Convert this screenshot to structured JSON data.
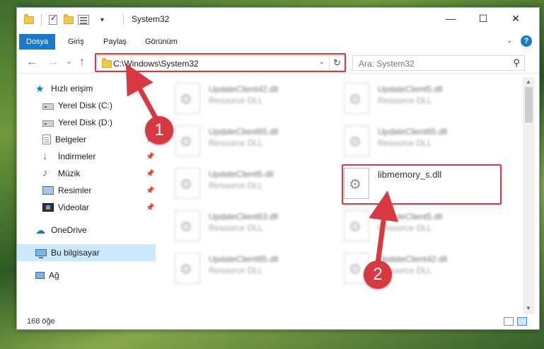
{
  "window": {
    "title": "System32",
    "controls": {
      "minimize": "—",
      "maximize": "☐",
      "close": "✕"
    }
  },
  "ribbon": {
    "tabs": [
      "Dosya",
      "Giriş",
      "Paylaş",
      "Görünüm"
    ],
    "active_tab": "Dosya",
    "help": "?"
  },
  "nav": {
    "back": "←",
    "forward": "→",
    "recent": "⌄",
    "up": "↑",
    "address": "C:\\Windows\\System32",
    "search_placeholder": "Ara: System32"
  },
  "sidebar": {
    "items": [
      {
        "label": "Hızlı erişim",
        "icon": "star-icon"
      },
      {
        "label": "Yerel Disk (C:)",
        "icon": "disk-icon"
      },
      {
        "label": "Yerel Disk (D:)",
        "icon": "disk-icon"
      },
      {
        "label": "Belgeler",
        "icon": "document-icon",
        "pinned": true
      },
      {
        "label": "İndirmeler",
        "icon": "download-icon",
        "pinned": true
      },
      {
        "label": "Müzik",
        "icon": "music-icon",
        "pinned": true
      },
      {
        "label": "Resimler",
        "icon": "pictures-icon",
        "pinned": true
      },
      {
        "label": "Videolar",
        "icon": "video-icon",
        "pinned": true
      },
      {
        "label": "OneDrive",
        "icon": "cloud-icon"
      },
      {
        "label": "Bu bilgisayar",
        "icon": "computer-icon",
        "selected": true
      },
      {
        "label": "Ağ",
        "icon": "network-icon"
      }
    ]
  },
  "files": [
    {
      "name": "UpdateClient42.dll",
      "type": "Resource DLL"
    },
    {
      "name": "UpdateClient5.dll",
      "type": "Resource DLL"
    },
    {
      "name": "UpdateClient65.dll",
      "type": "Resource DLL"
    },
    {
      "name": "UpdateClient65.dll",
      "type": "Resource DLL"
    },
    {
      "name": "UpdateClient5.dll",
      "type": "Resource DLL"
    },
    {
      "name": "libmemory_s.dll",
      "type": ""
    },
    {
      "name": "UpdateClient63.dll",
      "type": "Resource DLL"
    },
    {
      "name": "UpdateClient5.dll",
      "type": "Resource DLL"
    },
    {
      "name": "UpdateClient65.dll",
      "type": "Resource DLL"
    },
    {
      "name": "UpdateClient42.dll",
      "type": "Resource DLL"
    }
  ],
  "status": {
    "item_count": "168 öğe"
  },
  "annotations": {
    "marker1": "1",
    "marker2": "2",
    "color": "#d8383f"
  }
}
